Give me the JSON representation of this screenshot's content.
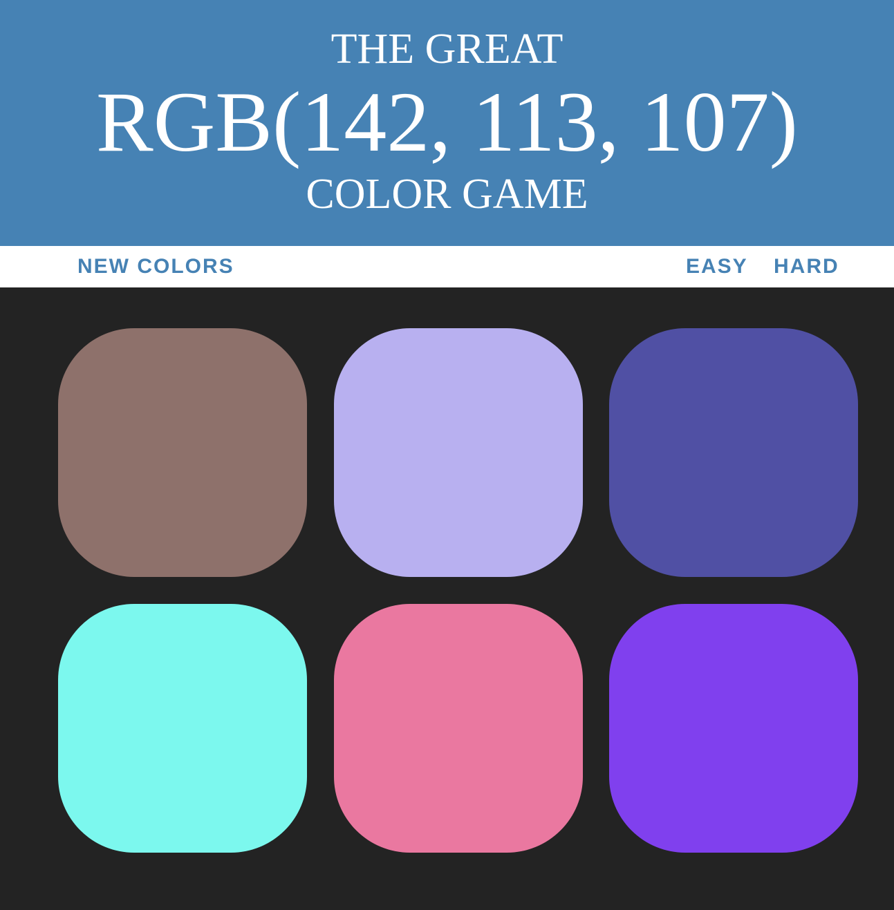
{
  "header": {
    "title_top": "THE GREAT",
    "target_rgb": "RGB(142, 113, 107)",
    "title_bottom": "COLOR GAME",
    "background": "#4682b4",
    "text_color": "#ffffff"
  },
  "controls": {
    "new_colors_label": "NEW COLORS",
    "easy_label": "EASY",
    "hard_label": "HARD",
    "accent_color": "#4682b4"
  },
  "board": {
    "background": "#232323",
    "squares": [
      {
        "color": "#8e716b"
      },
      {
        "color": "#b8b0f0"
      },
      {
        "color": "#5050a4"
      },
      {
        "color": "#7cf8ee"
      },
      {
        "color": "#ea78a0"
      },
      {
        "color": "#8040ee"
      }
    ]
  }
}
